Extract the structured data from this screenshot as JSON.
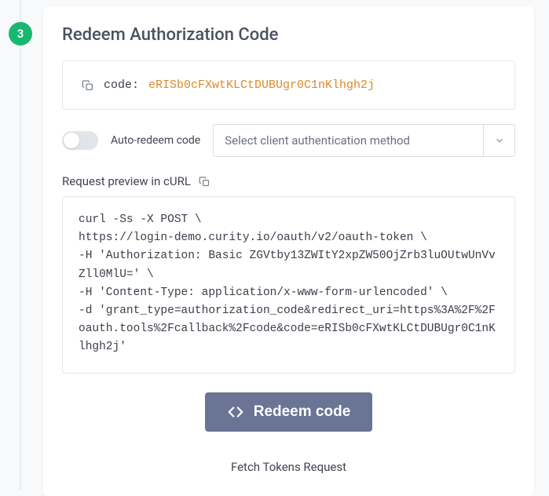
{
  "step": "3",
  "title": "Redeem Authorization Code",
  "code": {
    "label": "code:",
    "value": "eRISb0cFXwtKLCtDUBUgr0C1nKlhgh2j"
  },
  "autoRedeem": {
    "label": "Auto-redeem code",
    "enabled": false
  },
  "authMethodSelect": {
    "placeholder": "Select client authentication method"
  },
  "previewLabel": "Request preview in cURL",
  "curl": "curl -Ss -X POST \\\nhttps://login-demo.curity.io/oauth/v2/oauth-token \\\n-H 'Authorization: Basic ZGVtby13ZWItY2xpZW50OjZrb3luOUtwUnVvZll0MlU=' \\\n-H 'Content-Type: application/x-www-form-urlencoded' \\\n-d 'grant_type=authorization_code&redirect_uri=https%3A%2F%2Foauth.tools%2Fcallback%2Fcode&code=eRISb0cFXwtKLCtDUBUgr0C1nKlhgh2j'",
  "redeemButton": "Redeem code",
  "footer": "Fetch Tokens Request"
}
